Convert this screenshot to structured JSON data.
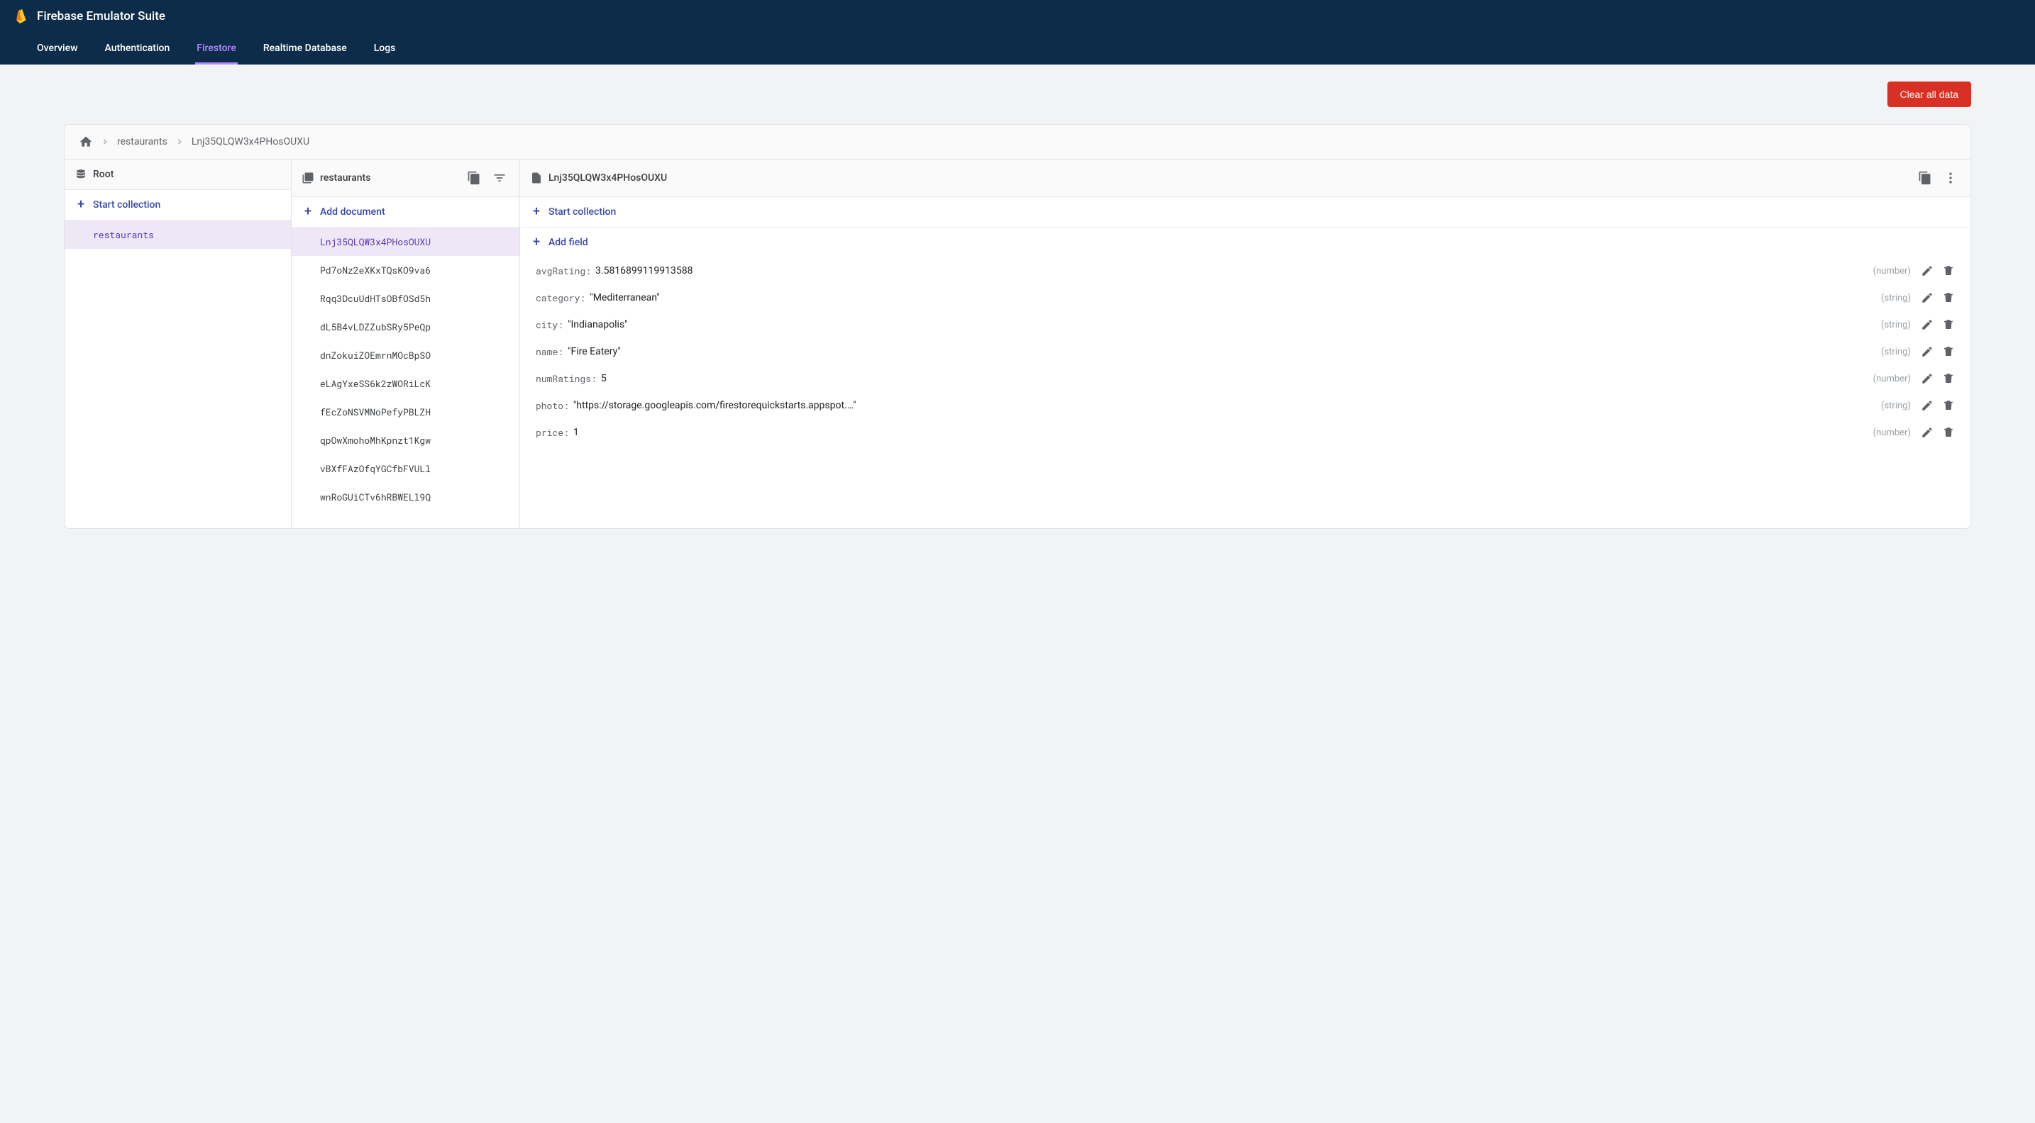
{
  "header": {
    "app_title": "Firebase Emulator Suite",
    "tabs": [
      {
        "label": "Overview",
        "active": false
      },
      {
        "label": "Authentication",
        "active": false
      },
      {
        "label": "Firestore",
        "active": true
      },
      {
        "label": "Realtime Database",
        "active": false
      },
      {
        "label": "Logs",
        "active": false
      }
    ]
  },
  "toolbar": {
    "clear_label": "Clear all data"
  },
  "breadcrumb": {
    "items": [
      "restaurants",
      "Lnj35QLQW3x4PHosOUXU"
    ]
  },
  "col_root": {
    "title": "Root",
    "add_label": "Start collection",
    "items": [
      {
        "label": "restaurants",
        "selected": true
      }
    ]
  },
  "col_docs": {
    "title": "restaurants",
    "add_label": "Add document",
    "items": [
      {
        "label": "Lnj35QLQW3x4PHosOUXU",
        "selected": true
      },
      {
        "label": "Pd7oNz2eXKxTQsKO9va6",
        "selected": false
      },
      {
        "label": "Rqq3DcuUdHTsOBfOSd5h",
        "selected": false
      },
      {
        "label": "dL5B4vLDZZubSRy5PeQp",
        "selected": false
      },
      {
        "label": "dnZokuiZOEmrnMOcBpSO",
        "selected": false
      },
      {
        "label": "eLAgYxeSS6k2zWORiLcK",
        "selected": false
      },
      {
        "label": "fEcZoNSVMNoPefyPBLZH",
        "selected": false
      },
      {
        "label": "qpOwXmohoMhKpnzt1Kgw",
        "selected": false
      },
      {
        "label": "vBXfFAzOfqYGCfbFVULl",
        "selected": false
      },
      {
        "label": "wnRoGUiCTv6hRBWELl9Q",
        "selected": false
      }
    ]
  },
  "col_fields": {
    "title": "Lnj35QLQW3x4PHosOUXU",
    "add_collection_label": "Start collection",
    "add_field_label": "Add field",
    "fields": [
      {
        "key": "avgRating",
        "value": "3.5816899119913588",
        "type": "number",
        "quoted": false
      },
      {
        "key": "category",
        "value": "Mediterranean",
        "type": "string",
        "quoted": true
      },
      {
        "key": "city",
        "value": "Indianapolis",
        "type": "string",
        "quoted": true
      },
      {
        "key": "name",
        "value": "Fire Eatery",
        "type": "string",
        "quoted": true
      },
      {
        "key": "numRatings",
        "value": "5",
        "type": "number",
        "quoted": false
      },
      {
        "key": "photo",
        "value": "https://storage.googleapis.com/firestorequickstarts.appspot.…",
        "type": "string",
        "quoted": true
      },
      {
        "key": "price",
        "value": "1",
        "type": "number",
        "quoted": false
      }
    ]
  }
}
